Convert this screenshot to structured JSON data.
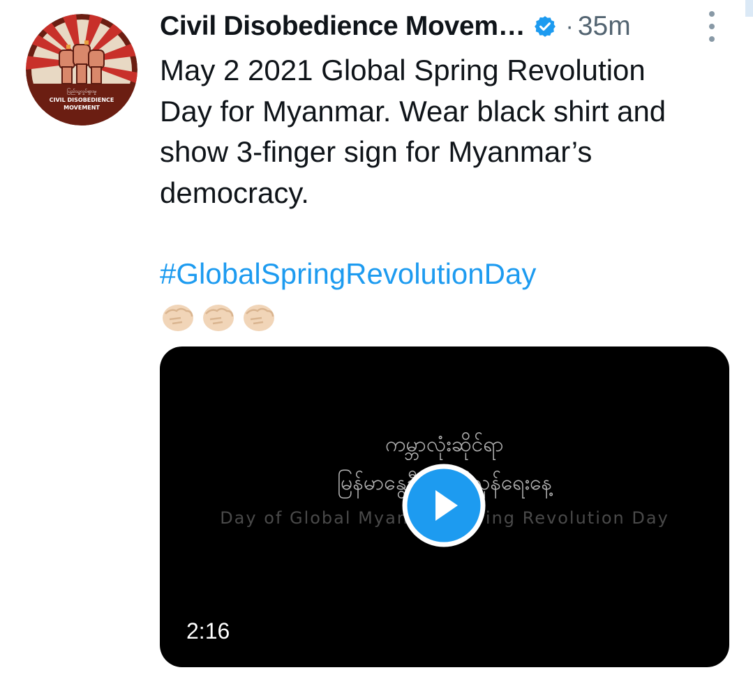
{
  "tweet": {
    "display_name": "Civil Disobedience Movem…",
    "separator": "·",
    "time": "35m",
    "avatar_caption_line1": "CIVIL DISOBEDIENCE",
    "avatar_caption_line2": "MOVEMENT",
    "text_lines": [
      "May 2 2021 Global Spring Revolution",
      "Day for Myanmar. Wear black shirt and",
      "show 3-finger sign for Myanmar’s",
      "democracy."
    ],
    "hashtag": "#GlobalSpringRevolutionDay",
    "emojis": [
      "fist-emoji",
      "fist-emoji",
      "fist-emoji"
    ]
  },
  "video": {
    "overlay_line1": "ကမ္ဘာလုံးဆိုင်ရာ",
    "overlay_line2": "မြန်မာနွေဦး တော်လှန်ရေးနေ့",
    "overlay_line3": "Day of Global Myanmar Spring Revolution Day",
    "duration": "2:16"
  },
  "colors": {
    "link": "#1d9bf0",
    "secondary": "#536471",
    "verified": "#1d9bf0",
    "avatar_bg": "#6b1e12",
    "avatar_ray": "#c8302a"
  },
  "icons": {
    "verified": "verified-badge-icon",
    "more": "more-vertical-icon",
    "play": "play-icon"
  }
}
